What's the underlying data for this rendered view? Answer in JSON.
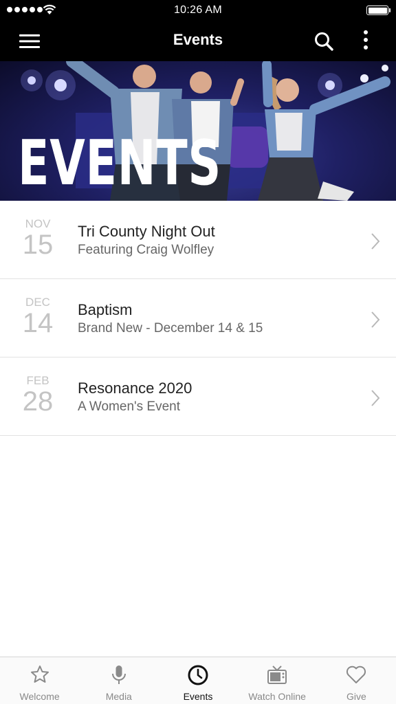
{
  "status_bar": {
    "time": "10:26 AM"
  },
  "nav": {
    "title": "Events"
  },
  "hero": {
    "title": "EVENTS"
  },
  "events": [
    {
      "month": "NOV",
      "day": "15",
      "title": "Tri County Night Out",
      "subtitle": "Featuring Craig Wolfley"
    },
    {
      "month": "DEC",
      "day": "14",
      "title": "Baptism",
      "subtitle": "Brand New - December 14 & 15"
    },
    {
      "month": "FEB",
      "day": "28",
      "title": "Resonance 2020",
      "subtitle": "A Women's Event"
    }
  ],
  "tabs": [
    {
      "label": "Welcome",
      "icon": "star-icon",
      "active": false
    },
    {
      "label": "Media",
      "icon": "microphone-icon",
      "active": false
    },
    {
      "label": "Events",
      "icon": "clock-icon",
      "active": true
    },
    {
      "label": "Watch Online",
      "icon": "tv-icon",
      "active": false
    },
    {
      "label": "Give",
      "icon": "heart-icon",
      "active": false
    }
  ],
  "colors": {
    "bar_background": "#000000",
    "tab_active": "#111111",
    "tab_inactive": "#888888",
    "date_gray": "#c4c4c4"
  }
}
